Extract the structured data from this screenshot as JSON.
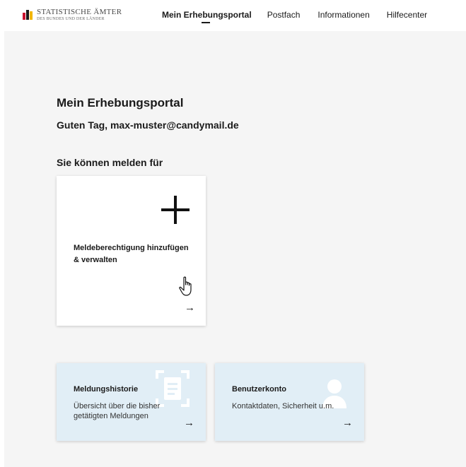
{
  "header": {
    "logo": {
      "line1": "STATISTISCHE ÄMTER",
      "line2": "DES BUNDES UND DER LÄNDER",
      "colors": [
        "#c8102e",
        "#1a1a1a",
        "#f2b600"
      ]
    },
    "nav": [
      {
        "label": "Mein Erhebungsportal",
        "active": true
      },
      {
        "label": "Postfach",
        "active": false
      },
      {
        "label": "Informationen",
        "active": false
      },
      {
        "label": "Hilfecenter",
        "active": false
      }
    ]
  },
  "main": {
    "title": "Mein Erhebungsportal",
    "greeting": "Guten Tag, max-muster@candymail.de",
    "section_title": "Sie können melden für",
    "add_card": {
      "icon": "plus-icon",
      "label": "Meldeberechtigung hinzufügen & verwalten",
      "arrow": "→"
    },
    "tiles": [
      {
        "title": "Meldungshistorie",
        "desc": "Übersicht über die bisher getätigten Meldungen",
        "arrow": "→",
        "icon": "document-scan-icon"
      },
      {
        "title": "Benutzerkonto",
        "desc": "Kontaktdaten, Sicherheit u.m.",
        "arrow": "→",
        "icon": "user-icon"
      }
    ]
  },
  "colors": {
    "page_bg": "#f5f5f5",
    "tile_bg": "#e1eef6",
    "card_bg": "#ffffff"
  }
}
